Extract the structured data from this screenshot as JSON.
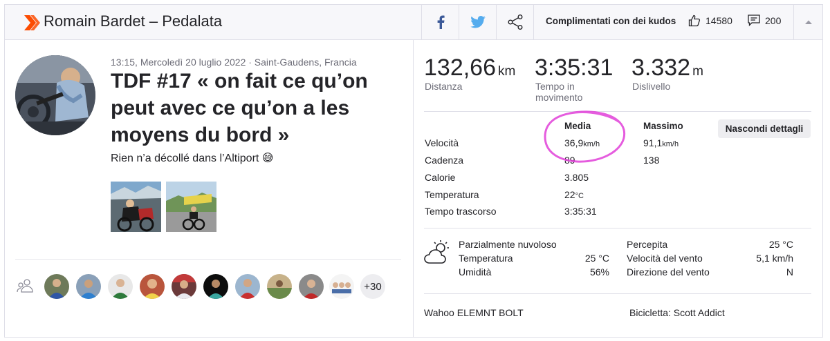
{
  "header": {
    "title": "Romain Bardet – Pedalata",
    "kudos_text": "Complimentati con dei kudos",
    "kudos_count": "14580",
    "comments_count": "200",
    "icons": [
      "facebook-icon",
      "twitter-icon",
      "share-icon",
      "thumbs-up-icon",
      "comment-icon",
      "collapse-icon"
    ],
    "brand_color": "#fc4c02"
  },
  "activity": {
    "meta": "13:15, Mercoledì 20 luglio 2022 · Saint-Gaudens, Francia",
    "title": "TDF #17 « on fait ce qu’on peut avec ce qu’on a les moyens du bord »",
    "description": "Rien n’a décollé dans l’Altiport 😅",
    "group_more": "+30"
  },
  "stats": {
    "distance": {
      "value": "132,66",
      "unit": "km",
      "label": "Distanza"
    },
    "moving_time": {
      "value": "3:35:31",
      "label": "Tempo in movimento"
    },
    "elevation": {
      "value": "3.332",
      "unit": "m",
      "label": "Dislivello"
    }
  },
  "details": {
    "col_avg": "Media",
    "col_max": "Massimo",
    "hide_button": "Nascondi dettagli",
    "rows": [
      {
        "label": "Velocità",
        "avg": "36,9",
        "avg_unit": "km/h",
        "max": "91,1",
        "max_unit": "km/h"
      },
      {
        "label": "Cadenza",
        "avg": "89",
        "avg_unit": "",
        "max": "138",
        "max_unit": ""
      },
      {
        "label": "Calorie",
        "avg": "3.805",
        "avg_unit": "",
        "max": "",
        "max_unit": ""
      },
      {
        "label": "Temperatura",
        "avg": "22",
        "avg_unit": "°C",
        "max": "",
        "max_unit": ""
      },
      {
        "label": "Tempo trascorso",
        "avg": "3:35:31",
        "avg_unit": "",
        "max": "",
        "max_unit": ""
      }
    ],
    "highlight_color": "#e040d8"
  },
  "weather": {
    "condition": "Parzialmente nuvoloso",
    "temp_label": "Temperatura",
    "temp_value": "25 °C",
    "humidity_label": "Umidità",
    "humidity_value": "56%",
    "feels_label": "Percepita",
    "feels_value": "25 °C",
    "wind_speed_label": "Velocità del vento",
    "wind_speed_value": "5,1 km/h",
    "wind_dir_label": "Direzione del vento",
    "wind_dir_value": "N"
  },
  "equipment": {
    "device": "Wahoo ELEMNT BOLT",
    "bike": "Bicicletta: Scott Addict"
  }
}
